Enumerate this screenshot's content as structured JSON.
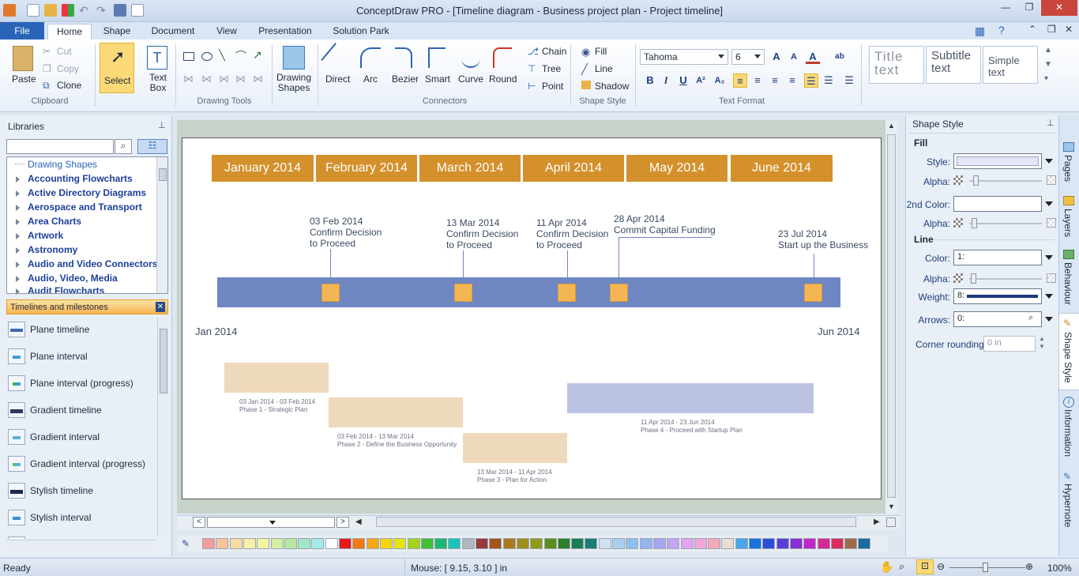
{
  "window": {
    "title": "ConceptDraw PRO - [Timeline diagram - Business project plan - Project timeline]",
    "minimize": "—",
    "maximize": "❐",
    "close": "✕"
  },
  "ribbon_tabs": [
    "File",
    "Home",
    "Shape",
    "Document",
    "View",
    "Presentation",
    "Solution Park"
  ],
  "clipboard": {
    "paste": "Paste",
    "cut": "Cut",
    "copy": "Copy",
    "clone": "Clone",
    "label": "Clipboard"
  },
  "select_label": "Select",
  "text_box_label": "Text Box",
  "drawing_tools_label": "Drawing Tools",
  "drawing_shapes_label": "Drawing Shapes",
  "connectors": {
    "items": [
      "Direct",
      "Arc",
      "Bezier",
      "Smart",
      "Curve",
      "Round"
    ],
    "chain": "Chain",
    "tree": "Tree",
    "point": "Point",
    "label": "Connectors"
  },
  "shape_style_group": {
    "fill": "Fill",
    "line": "Line",
    "shadow": "Shadow",
    "label": "Shape Style"
  },
  "text_format": {
    "font": "Tahoma",
    "size": "6",
    "label": "Text Format"
  },
  "text_styles": [
    {
      "line1": "Title",
      "line2": "text"
    },
    {
      "line1": "Subtitle",
      "line2": "text"
    },
    {
      "line1": "Simple",
      "line2": "text"
    }
  ],
  "libraries": {
    "title": "Libraries",
    "search_placeholder": "",
    "items": [
      "Drawing Shapes",
      "Accounting Flowcharts",
      "Active Directory Diagrams",
      "Aerospace and Transport",
      "Area Charts",
      "Artwork",
      "Astronomy",
      "Audio and Video Connectors",
      "Audio, Video, Media",
      "Audit Flowcharts"
    ],
    "active_library": "Timelines and milestones",
    "shapes": [
      "Plane timeline",
      "Plane interval",
      "Plane interval (progress)",
      "Gradient timeline",
      "Gradient interval",
      "Gradient interval (progress)",
      "Stylish timeline",
      "Stylish interval"
    ]
  },
  "diagram": {
    "months": [
      "January 2014",
      "February 2014",
      "March 2014",
      "April 2014",
      "May 2014",
      "June 2014"
    ],
    "milestones": [
      {
        "date": "03 Feb 2014",
        "l1": "Confirm Decision",
        "l2": "to Proceed"
      },
      {
        "date": "13 Mar 2014",
        "l1": "Confirm Decision",
        "l2": "to Proceed"
      },
      {
        "date": "11 Apr 2014",
        "l1": "Confirm Decision",
        "l2": "to Proceed"
      },
      {
        "date": "28 Apr 2014",
        "l1": "Commit Capital Funding",
        "l2": ""
      },
      {
        "date": "23 Jul 2014",
        "l1": "Start up the Business",
        "l2": ""
      }
    ],
    "axis_start": "Jan 2014",
    "axis_end": "Jun 2014",
    "phases": [
      {
        "dates": "03 Jan 2014 - 03 Feb 2014",
        "name": "Phase 1 - Strategic Plan",
        "color": "#efd9bd"
      },
      {
        "dates": "03 Feb 2014 - 13 Mar 2014",
        "name": "Phase 2 - Define the Business Opportunity",
        "color": "#efd9bd"
      },
      {
        "dates": "13 Mar 2014 - 11 Apr 2014",
        "name": "Phase 3 - Plan for Action",
        "color": "#efd9bd"
      },
      {
        "dates": "11 Apr 2014 - 23 Jun 2014",
        "name": "Phase 4 - Proceed with Startup Plan",
        "color": "#bcc3e2"
      }
    ]
  },
  "shape_style_panel": {
    "title": "Shape Style",
    "fill_head": "Fill",
    "style_label": "Style:",
    "alpha_label": "Alpha:",
    "second_color_label": "2nd Color:",
    "line_head": "Line",
    "color_label": "Color:",
    "color_value": "1:",
    "weight_label": "Weight:",
    "weight_value": "8:",
    "arrows_label": "Arrows:",
    "arrows_value": "0:",
    "corner_label": "Corner rounding:",
    "corner_value": "0 in"
  },
  "right_tabs": [
    "Pages",
    "Layers",
    "Behaviour",
    "Shape Style",
    "Information",
    "Hypernote"
  ],
  "status": {
    "ready": "Ready",
    "mouse": "Mouse: [ 9.15, 3.10 ] in",
    "zoom": "100%"
  },
  "palette_colors": [
    "#f49c9c",
    "#f7c49a",
    "#f9dba0",
    "#fbeea6",
    "#f4f3a0",
    "#d6ef9f",
    "#b6e8a0",
    "#a3e6c2",
    "#a6ece6",
    "#ffffff",
    "#e81818",
    "#f27a10",
    "#f7a513",
    "#f8d40f",
    "#e3e611",
    "#a4d51a",
    "#3fbf31",
    "#1ab871",
    "#19c2b7",
    "#b0b6bf",
    "#9a3a3a",
    "#a5541c",
    "#a8791d",
    "#9e8e1c",
    "#8f9a1b",
    "#5b8e1d",
    "#2e7f2b",
    "#1a7c55",
    "#1b7d78",
    "#cfe0ee",
    "#a8d0ee",
    "#8fbfef",
    "#98b4f0",
    "#a6a6f2",
    "#c3a6f2",
    "#e2a6f0",
    "#f1a6d8",
    "#f2a9b9",
    "#e9ddd2",
    "#4aa6ea",
    "#1a73e0",
    "#2b4fd8",
    "#5a3ed6",
    "#8a2fd4",
    "#bf27c8",
    "#d52896",
    "#dc2c5b",
    "#a16a4a",
    "#1a6d9a"
  ]
}
